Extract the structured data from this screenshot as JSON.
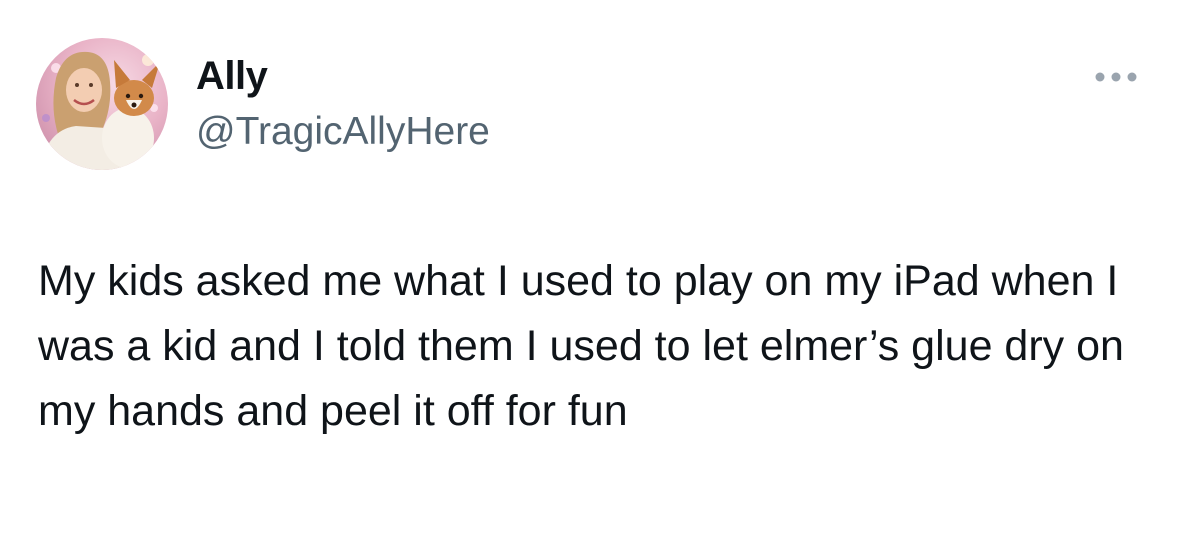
{
  "author": {
    "display_name": "Ally",
    "handle": "@TragicAllyHere",
    "avatar_icon": "profile-photo-woman-holding-corgi"
  },
  "more_menu": {
    "icon": "more-horizontal-icon"
  },
  "tweet": {
    "text": "My kids asked me what I used to play on my iPad when I was a kid and I told them I used to let elmer’s glue dry on my hands and peel it off for fun"
  },
  "colors": {
    "primary_text": "#0f1419",
    "secondary_text": "#536471",
    "background": "#ffffff"
  }
}
